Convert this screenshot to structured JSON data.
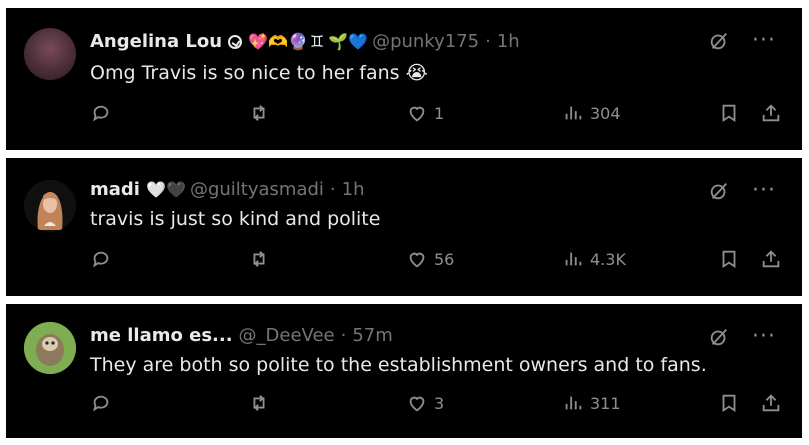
{
  "tweets": [
    {
      "name": "Angelina Lou",
      "emojis": [
        "💖",
        "🫶",
        "🔮",
        "♊",
        "🌱",
        "💙"
      ],
      "handle": "@punky175",
      "time": "1h",
      "text": "Omg Travis is so nice to her fans 😭",
      "likes": "1",
      "views": "304"
    },
    {
      "name": "madi",
      "emojis": [
        "🤍",
        "🖤"
      ],
      "handle": "@guiltyasmadi",
      "time": "1h",
      "text": "travis is just so kind and polite",
      "likes": "56",
      "views": "4.3K"
    },
    {
      "name": "me llamo es...",
      "emojis": [],
      "handle": "@_DeeVee",
      "time": "57m",
      "text": "They are both so polite to the establishment owners and to fans.",
      "likes": "3",
      "views": "311"
    }
  ],
  "icons": [
    "grok-icon",
    "more-icon",
    "reply-icon",
    "repost-icon",
    "like-icon",
    "views-icon",
    "bookmark-icon",
    "share-icon"
  ],
  "colors": {
    "background": "#000000",
    "text": "#e7e9ea",
    "muted": "#71767b"
  }
}
